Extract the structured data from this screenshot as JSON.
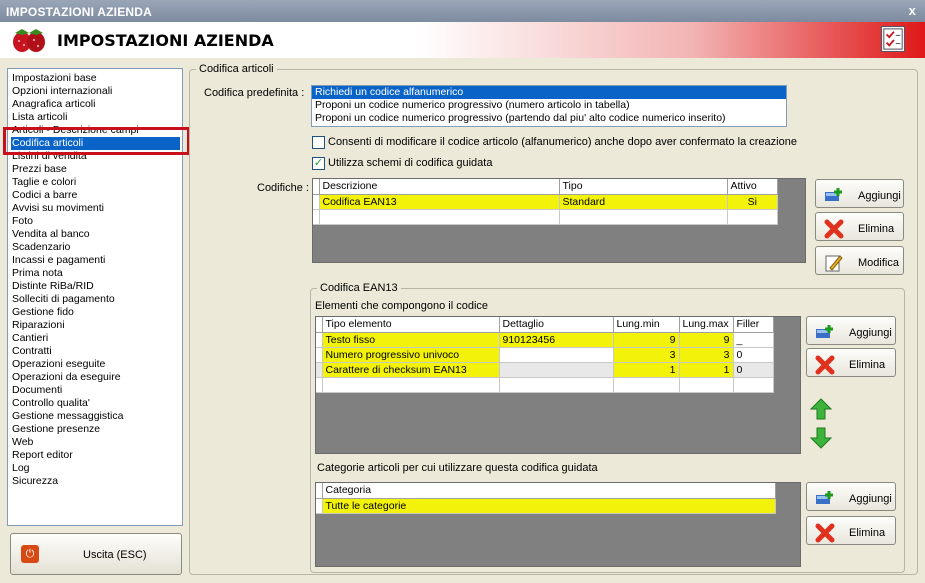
{
  "window": {
    "title": "IMPOSTAZIONI AZIENDA",
    "close_label": "x"
  },
  "header": {
    "title": "IMPOSTAZIONI AZIENDA"
  },
  "sidebar": {
    "items": [
      {
        "label": "Impostazioni base"
      },
      {
        "label": "Opzioni internazionali"
      },
      {
        "label": "Anagrafica articoli"
      },
      {
        "label": "Lista articoli"
      },
      {
        "label": "Articoli - Descrizione campi"
      },
      {
        "label": "Codifica articoli",
        "selected": true
      },
      {
        "label": "Listini di vendita"
      },
      {
        "label": "Prezzi base"
      },
      {
        "label": "Taglie e colori"
      },
      {
        "label": "Codici a barre"
      },
      {
        "label": "Avvisi su movimenti"
      },
      {
        "label": "Foto"
      },
      {
        "label": "Vendita al banco"
      },
      {
        "label": "Scadenzario"
      },
      {
        "label": "Incassi e pagamenti"
      },
      {
        "label": "Prima nota"
      },
      {
        "label": "Distinte RiBa/RID"
      },
      {
        "label": "Solleciti di pagamento"
      },
      {
        "label": "Gestione fido"
      },
      {
        "label": "Riparazioni"
      },
      {
        "label": "Cantieri"
      },
      {
        "label": "Contratti"
      },
      {
        "label": "Operazioni eseguite"
      },
      {
        "label": "Operazioni da eseguire"
      },
      {
        "label": "Documenti"
      },
      {
        "label": "Controllo qualita'"
      },
      {
        "label": "Gestione messaggistica"
      },
      {
        "label": "Gestione presenze"
      },
      {
        "label": "Web"
      },
      {
        "label": "Report editor"
      },
      {
        "label": "Log"
      },
      {
        "label": "Sicurezza"
      }
    ]
  },
  "exit_button": {
    "label": "Uscita (ESC)"
  },
  "codifica": {
    "group_label": "Codifica articoli",
    "predefinita_label": "Codifica predefinita :",
    "options": [
      "Richiedi un codice alfanumerico",
      "Proponi un codice numerico progressivo (numero articolo in tabella)",
      "Proponi un codice numerico progressivo (partendo dal piu' alto codice numerico inserito)"
    ],
    "selected_option": 0,
    "check_modifica": {
      "label": "Consenti di modificare il codice articolo (alfanumerico) anche dopo aver confermato la creazione",
      "checked": false
    },
    "check_schemi": {
      "label": "Utilizza schemi di codifica guidata",
      "checked": true,
      "mark": "✓"
    },
    "codifiche_label": "Codifiche :",
    "codifiche_table": {
      "headers": [
        "Descrizione",
        "Tipo",
        "Attivo"
      ],
      "rows": [
        [
          "Codifica EAN13",
          "Standard",
          "Si"
        ]
      ]
    },
    "buttons": {
      "aggiungi": "Aggiungi",
      "elimina": "Elimina",
      "modifica": "Modifica"
    }
  },
  "ean13": {
    "group_label": "Codifica EAN13",
    "elementi_label": "Elementi che compongono il codice",
    "table": {
      "headers": [
        "Tipo elemento",
        "Dettaglio",
        "Lung.min",
        "Lung.max",
        "Filler"
      ],
      "rows": [
        [
          "Testo fisso",
          "910123456",
          "9",
          "9",
          "_"
        ],
        [
          "Numero progressivo univoco",
          "",
          "3",
          "3",
          "0"
        ],
        [
          "Carattere di checksum EAN13",
          "",
          "1",
          "1",
          "0"
        ]
      ]
    },
    "buttons": {
      "aggiungi": "Aggiungi",
      "elimina": "Elimina"
    },
    "categorie_label": "Categorie articoli per cui utilizzare questa codifica guidata",
    "categorie_table": {
      "headers": [
        "Categoria"
      ],
      "rows": [
        [
          "Tutte le categorie"
        ]
      ]
    },
    "cat_buttons": {
      "aggiungi": "Aggiungi",
      "elimina": "Elimina"
    }
  },
  "colors": {
    "highlight": "#f2f20a",
    "selection": "#0a64c8",
    "accent_red": "#e01818"
  }
}
